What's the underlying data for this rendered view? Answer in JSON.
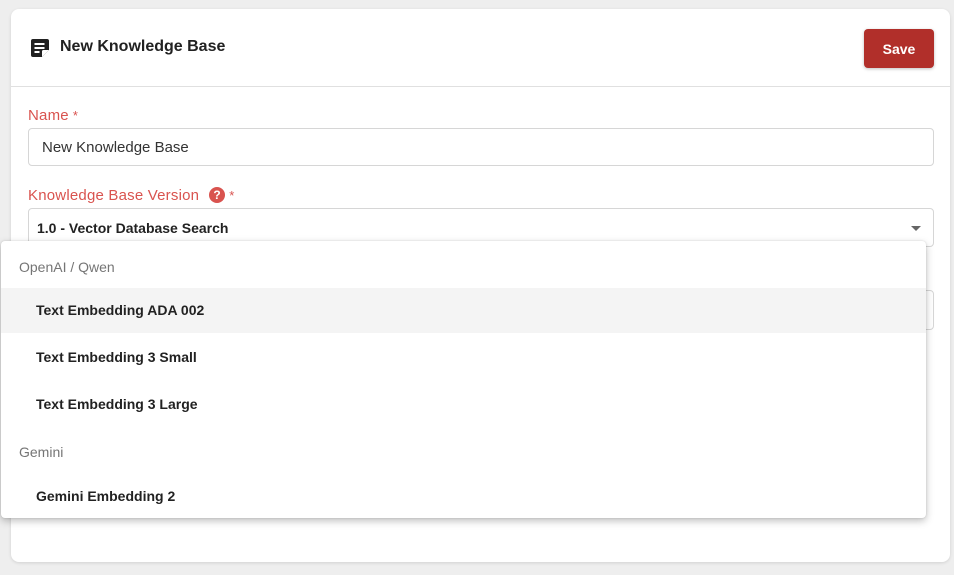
{
  "header": {
    "title": "New Knowledge Base",
    "icon": "document-edit-icon",
    "save_label": "Save"
  },
  "form": {
    "name": {
      "label": "Name",
      "required_mark": "*",
      "value": "New Knowledge Base"
    },
    "version": {
      "label": "Knowledge Base Version",
      "help_glyph": "?",
      "required_mark": "*",
      "selected": "1.0 - Vector Database Search"
    }
  },
  "dropdown": {
    "groups": [
      {
        "label": "OpenAI / Qwen",
        "options": [
          "Text Embedding ADA 002",
          "Text Embedding 3 Small",
          "Text Embedding 3 Large"
        ]
      },
      {
        "label": "Gemini",
        "options": [
          "Gemini Embedding 2"
        ]
      }
    ],
    "highlighted": "Text Embedding ADA 002"
  },
  "colors": {
    "accent": "#b12f2a",
    "label": "#d9534f",
    "highlight_row": "#f4f4f4"
  }
}
